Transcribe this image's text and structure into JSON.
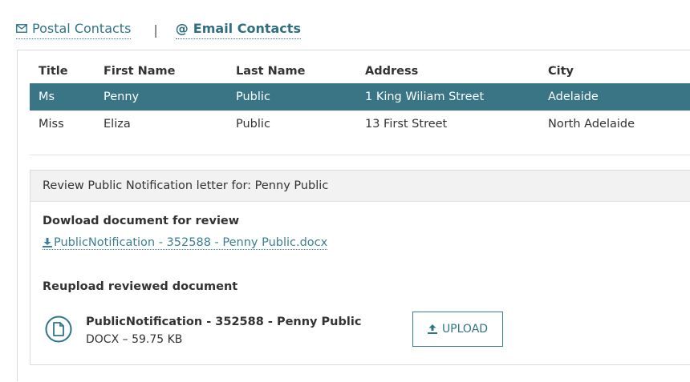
{
  "tabs": {
    "postal": {
      "label": "Postal Contacts",
      "icon": "envelope-icon"
    },
    "separator": "|",
    "email": {
      "label": "Email Contacts",
      "icon": "at-sign-icon",
      "glyph": "@"
    }
  },
  "contacts": {
    "columns": [
      "Title",
      "First Name",
      "Last Name",
      "Address",
      "City"
    ],
    "rows": [
      {
        "title": "Ms",
        "first": "Penny",
        "last": "Public",
        "address": "1 King Wiliam Street",
        "city": "Adelaide",
        "selected": true
      },
      {
        "title": "Miss",
        "first": "Eliza",
        "last": "Public",
        "address": "13 First Street",
        "city": "North Adelaide",
        "selected": false
      }
    ]
  },
  "review": {
    "heading": "Review Public Notification letter for: Penny Public",
    "download_title": "Dowload document for review",
    "download_link": "PublicNotification - 352588 - Penny Public.docx",
    "reupload_title": "Reupload reviewed document",
    "file_name": "PublicNotification - 352588 - Penny Public",
    "file_meta": "DOCX – 59.75 KB",
    "upload_label": "UPLOAD"
  },
  "colors": {
    "accent": "#2f7588",
    "selected_row": "#3a7585",
    "panel_header": "#f2f2f2"
  }
}
